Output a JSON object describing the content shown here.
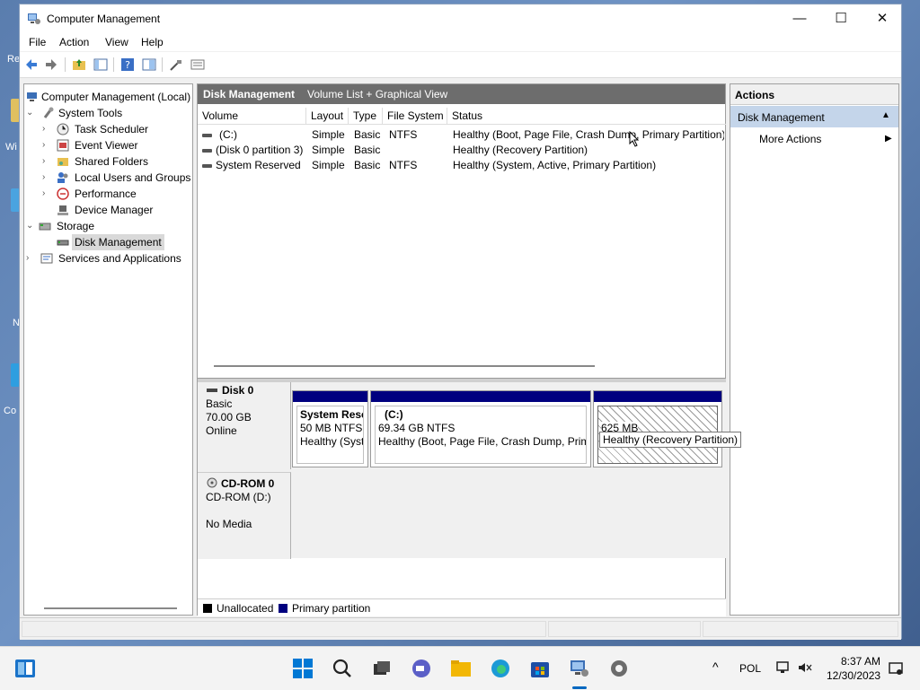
{
  "desktop": {
    "fragments": [
      "Re",
      "Wi",
      "N",
      "Co"
    ]
  },
  "window": {
    "title": "Computer Management",
    "controls": {
      "minimize": "—",
      "maximize": "☐",
      "close": "✕"
    }
  },
  "menu": [
    "File",
    "Action",
    "View",
    "Help"
  ],
  "tree": {
    "items": [
      {
        "label": "Computer Management (Local)",
        "expander": ""
      },
      {
        "label": "System Tools",
        "expander": "⌄"
      },
      {
        "label": "Task Scheduler",
        "expander": "›"
      },
      {
        "label": "Event Viewer",
        "expander": "›"
      },
      {
        "label": "Shared Folders",
        "expander": "›"
      },
      {
        "label": "Local Users and Groups",
        "expander": "›"
      },
      {
        "label": "Performance",
        "expander": "›"
      },
      {
        "label": "Device Manager",
        "expander": ""
      },
      {
        "label": "Storage",
        "expander": "⌄"
      },
      {
        "label": "Disk Management",
        "expander": "",
        "selected": true
      },
      {
        "label": "Services and Applications",
        "expander": "›"
      }
    ]
  },
  "center": {
    "header_title": "Disk Management",
    "header_view": "Volume List + Graphical View",
    "columns": [
      "Volume",
      "Layout",
      "Type",
      "File System",
      "Status"
    ],
    "rows": [
      {
        "volume": "(C:)",
        "layout": "Simple",
        "type": "Basic",
        "fs": "NTFS",
        "status": "Healthy (Boot, Page File, Crash Dump, Primary Partition)"
      },
      {
        "volume": "(Disk 0 partition 3)",
        "layout": "Simple",
        "type": "Basic",
        "fs": "",
        "status": "Healthy (Recovery Partition)"
      },
      {
        "volume": "System Reserved",
        "layout": "Simple",
        "type": "Basic",
        "fs": "NTFS",
        "status": "Healthy (System, Active, Primary Partition)"
      }
    ]
  },
  "disks": {
    "disk0": {
      "name": "Disk 0",
      "kind": "Basic",
      "size": "70.00 GB",
      "state": "Online",
      "partitions": [
        {
          "title": "System Rese",
          "size": "50 MB NTFS",
          "status": "Healthy (Syste"
        },
        {
          "title": "(C:)",
          "size": "69.34 GB NTFS",
          "status": "Healthy (Boot, Page File, Crash Dump, Prima"
        },
        {
          "title": "",
          "size": "625 MB",
          "status": ""
        }
      ]
    },
    "cdrom0": {
      "name": "CD-ROM 0",
      "drive": "CD-ROM (D:)",
      "state": "No Media"
    },
    "tooltip": "Healthy (Recovery Partition)"
  },
  "legend": [
    {
      "label": "Unallocated",
      "color": "#000000"
    },
    {
      "label": "Primary partition",
      "color": "#00007f"
    }
  ],
  "actions": {
    "header": "Actions",
    "section": "Disk Management",
    "section_arrow": "▲",
    "item": "More Actions",
    "item_arrow": "▶"
  },
  "taskbar": {
    "language": "POL",
    "time": "8:37 AM",
    "date": "12/30/2023",
    "tray_chevron": "^"
  },
  "colors": {
    "primary_partition": "#00007f",
    "header_bg": "#6d6d6d",
    "accent": "#0067c0"
  }
}
